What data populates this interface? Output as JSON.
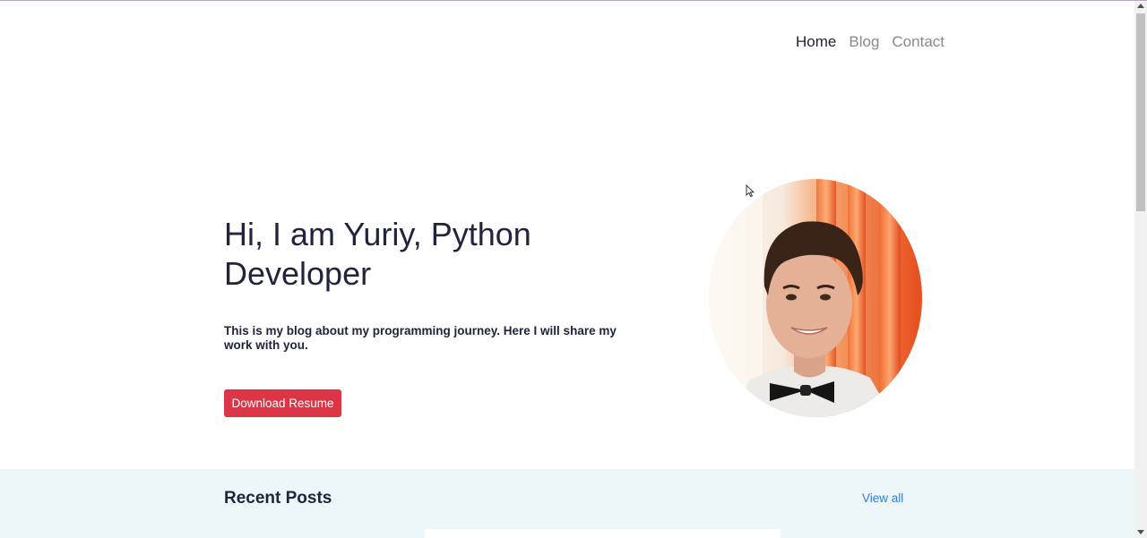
{
  "nav": {
    "items": [
      {
        "label": "Home"
      },
      {
        "label": "Blog"
      },
      {
        "label": "Contact"
      }
    ]
  },
  "hero": {
    "title": "Hi, I am Yuriy, Python Developer",
    "subtitle": "This is my blog about my programming journey. Here I will share my work with you.",
    "button_label": "Download Resume"
  },
  "recent_posts": {
    "title": "Recent Posts",
    "view_all_label": "View all"
  },
  "colors": {
    "accent": "#dc3545",
    "link": "#2c7be5",
    "text": "#21243d",
    "section_bg": "#edf7fa"
  }
}
